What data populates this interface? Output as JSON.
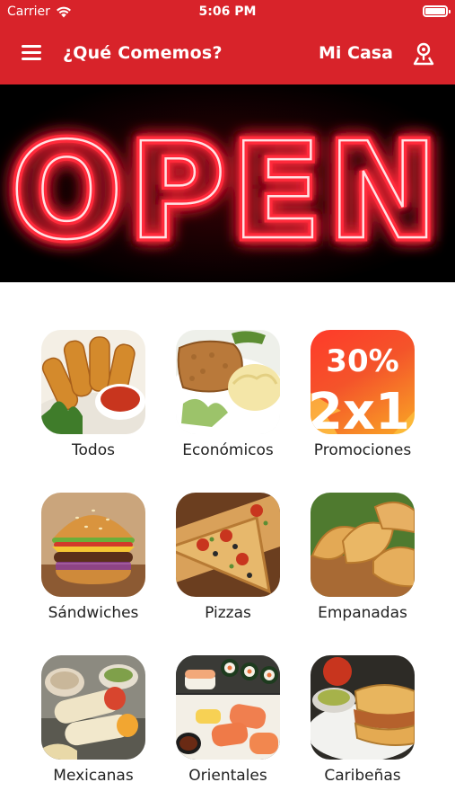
{
  "status_bar": {
    "carrier": "Carrier",
    "time": "5:06 PM"
  },
  "header": {
    "title": "¿Qué Comemos?",
    "location": "Mi Casa"
  },
  "banner": {
    "sign_text": "OPEN",
    "glow_color": "#ff2a3a"
  },
  "promo_tile": {
    "line1": "30%",
    "line2": "2x1"
  },
  "categories": [
    {
      "label": "Todos",
      "icon": "mozzarella-sticks-image"
    },
    {
      "label": "Económicos",
      "icon": "schnitzel-mash-image"
    },
    {
      "label": "Promociones",
      "icon": "promo-image"
    },
    {
      "label": "Sándwiches",
      "icon": "burger-image"
    },
    {
      "label": "Pizzas",
      "icon": "pizza-image"
    },
    {
      "label": "Empanadas",
      "icon": "empanadas-image"
    },
    {
      "label": "Mexicanas",
      "icon": "burritos-image"
    },
    {
      "label": "Orientales",
      "icon": "sushi-image"
    },
    {
      "label": "Caribeñas",
      "icon": "arepa-image"
    }
  ],
  "colors": {
    "brand_red": "#d8232a",
    "text": "#222222"
  }
}
